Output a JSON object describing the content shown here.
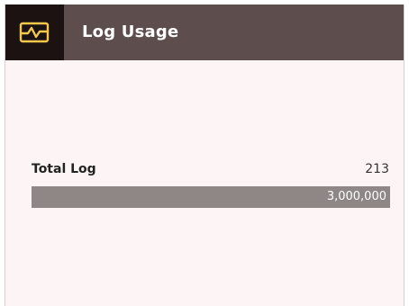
{
  "header": {
    "title": "Log Usage",
    "icon": "waveform-monitor-icon",
    "accent_color": "#f2c94c"
  },
  "usage": {
    "label": "Total Log",
    "value": "213",
    "max": "3,000,000",
    "fill_percent": 100
  }
}
